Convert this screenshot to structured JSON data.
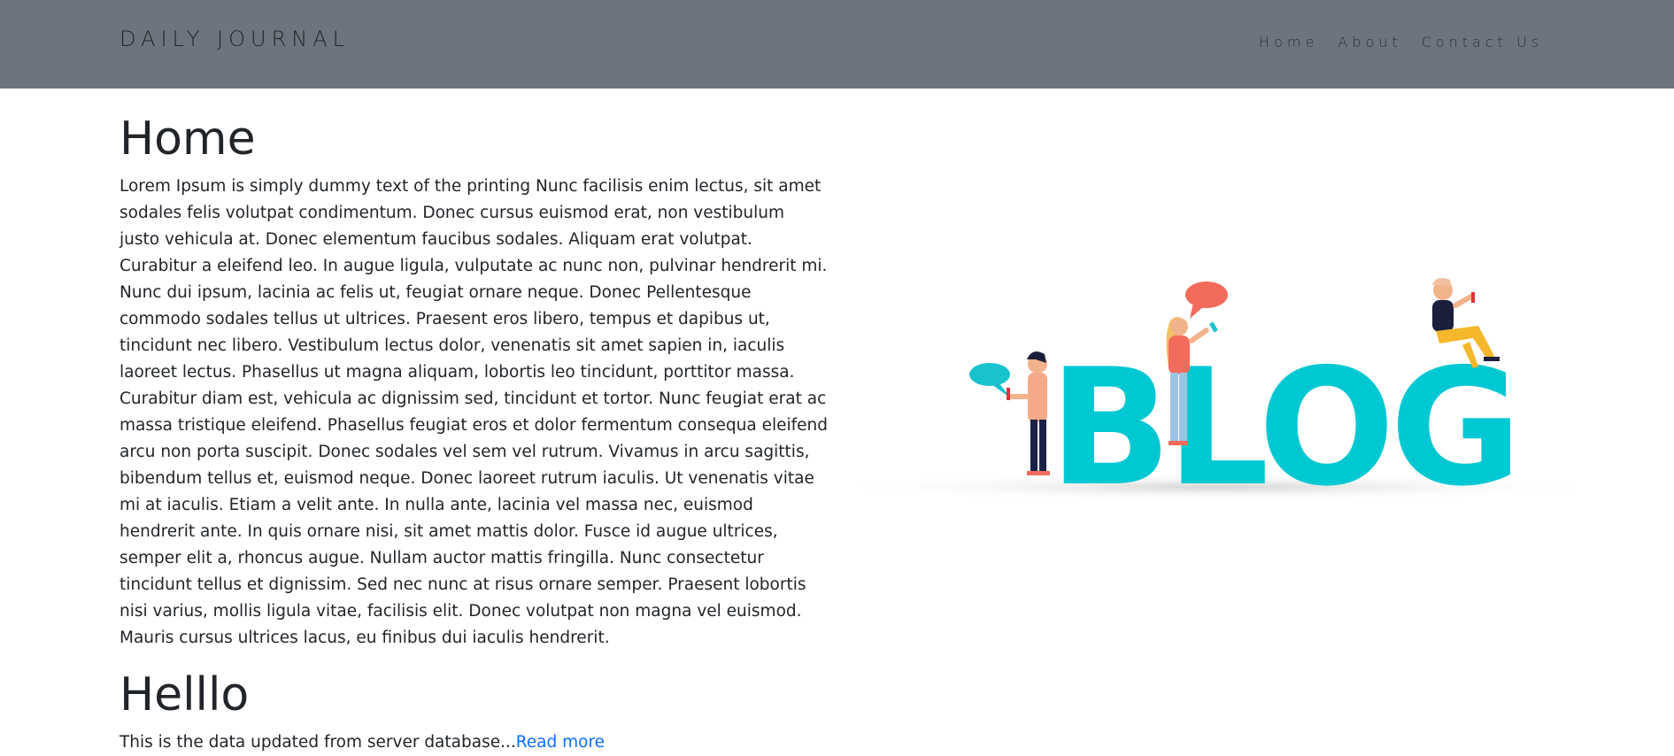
{
  "navbar": {
    "brand": "DAILY JOURNAL",
    "links": [
      {
        "label": "Home"
      },
      {
        "label": "About"
      },
      {
        "label": "Contact Us"
      }
    ],
    "bg_color": "#6c757d"
  },
  "main": {
    "title": "Home",
    "body": "Lorem Ipsum is simply dummy text of the printing Nunc facilisis enim lectus, sit amet sodales felis volutpat condimentum. Donec cursus euismod erat, non vestibulum justo vehicula at. Donec elementum faucibus sodales. Aliquam erat volutpat. Curabitur a eleifend leo. In augue ligula, vulputate ac nunc non, pulvinar hendrerit mi. Nunc dui ipsum, lacinia ac felis ut, feugiat ornare neque. Donec Pellentesque commodo sodales tellus ut ultrices. Praesent eros libero, tempus et dapibus ut, tincidunt nec libero. Vestibulum lectus dolor, venenatis sit amet sapien in, iaculis laoreet lectus. Phasellus ut magna aliquam, lobortis leo tincidunt, porttitor massa. Curabitur diam est, vehicula ac dignissim sed, tincidunt et tortor. Nunc feugiat erat ac massa tristique eleifend. Phasellus feugiat eros et dolor fermentum consequa eleifend arcu non porta suscipit. Donec sodales vel sem vel rutrum. Vivamus in arcu sagittis, bibendum tellus et, euismod neque. Donec laoreet rutrum iaculis. Ut venenatis vitae mi at iaculis. Etiam a velit ante. In nulla ante, lacinia vel massa nec, euismod hendrerit ante. In quis ornare nisi, sit amet mattis dolor. Fusce id augue ultrices, semper elit a, rhoncus augue. Nullam auctor mattis fringilla. Nunc consectetur tincidunt tellus et dignissim. Sed nec nunc at risus ornare semper. Praesent lobortis nisi varius, mollis ligula vitae, facilisis elit. Donec volutpat non magna vel euismod. Mauris cursus ultrices lacus, eu finibus dui iaculis hendrerit."
  },
  "posts": [
    {
      "title": "Helllo",
      "excerpt": "This is the data updated from server database...",
      "read_more": "Read more"
    }
  ],
  "hero_image": {
    "text": "BLOG",
    "accent_color": "#00c8d2",
    "bubble_colors": [
      "#19c3cd",
      "#f26b5b"
    ]
  },
  "link_color": "#0d6efd"
}
